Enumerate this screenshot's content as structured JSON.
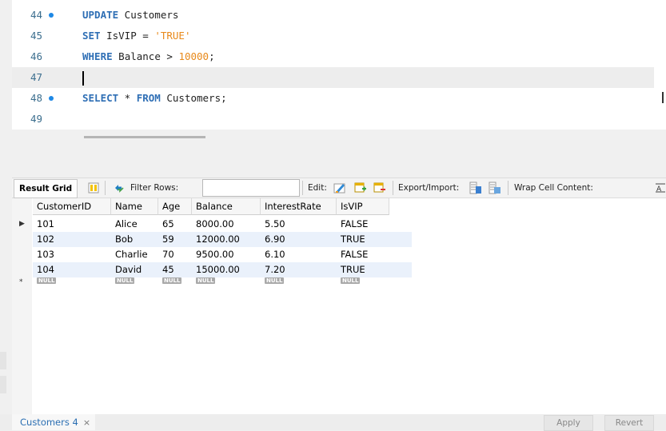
{
  "editor": {
    "lines": [
      {
        "num": "44",
        "has_dot": true,
        "tokens": [
          {
            "t": "UPDATE",
            "c": "kw"
          },
          {
            "t": " Customers",
            "c": ""
          }
        ]
      },
      {
        "num": "45",
        "has_dot": false,
        "tokens": [
          {
            "t": "SET",
            "c": "kw"
          },
          {
            "t": " IsVIP = ",
            "c": ""
          },
          {
            "t": "'TRUE'",
            "c": "str"
          }
        ]
      },
      {
        "num": "46",
        "has_dot": false,
        "tokens": [
          {
            "t": "WHERE",
            "c": "kw"
          },
          {
            "t": " Balance > ",
            "c": ""
          },
          {
            "t": "10000",
            "c": "num"
          },
          {
            "t": ";",
            "c": ""
          }
        ]
      },
      {
        "num": "47",
        "has_dot": false,
        "tokens": [],
        "current": true
      },
      {
        "num": "48",
        "has_dot": true,
        "tokens": [
          {
            "t": "SELECT",
            "c": "kw"
          },
          {
            "t": " * ",
            "c": ""
          },
          {
            "t": "FROM",
            "c": "kw"
          },
          {
            "t": " Customers;",
            "c": ""
          }
        ]
      },
      {
        "num": "49",
        "has_dot": false,
        "tokens": []
      }
    ]
  },
  "toolbar": {
    "result_grid_label": "Result Grid",
    "filter_rows_label": "Filter Rows:",
    "filter_rows_value": "",
    "edit_label": "Edit:",
    "export_import_label": "Export/Import:",
    "wrap_label": "Wrap Cell Content:"
  },
  "grid": {
    "columns": [
      "CustomerID",
      "Name",
      "Age",
      "Balance",
      "InterestRate",
      "IsVIP"
    ],
    "rows": [
      [
        "101",
        "Alice",
        "65",
        "8000.00",
        "5.50",
        "FALSE"
      ],
      [
        "102",
        "Bob",
        "59",
        "12000.00",
        "6.90",
        "TRUE"
      ],
      [
        "103",
        "Charlie",
        "70",
        "9500.00",
        "6.10",
        "FALSE"
      ],
      [
        "104",
        "David",
        "45",
        "15000.00",
        "7.20",
        "TRUE"
      ]
    ],
    "null_label": "NULL"
  },
  "bottom": {
    "tab_label": "Customers 4",
    "close_glyph": "×",
    "apply_label": "Apply",
    "revert_label": "Revert"
  },
  "colors": {
    "keyword": "#2f6fb5",
    "string": "#e8891a",
    "line_number": "#3b6e8e",
    "breakpoint_dot": "#1e88e5",
    "alt_row": "#eaf1fb"
  }
}
